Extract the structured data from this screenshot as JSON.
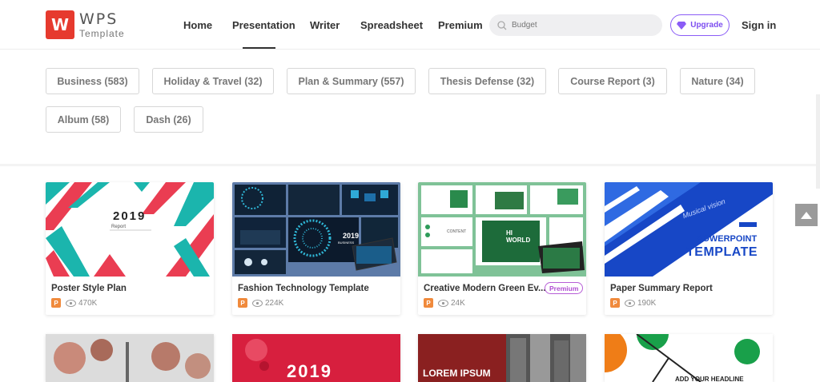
{
  "brand": {
    "mark": "W",
    "name": "WPS",
    "sub": "Template",
    "color": "#e63a2e"
  },
  "nav": [
    {
      "label": "Home"
    },
    {
      "label": "Presentation"
    },
    {
      "label": "Writer"
    },
    {
      "label": "Spreadsheet"
    },
    {
      "label": "Premium"
    }
  ],
  "search": {
    "placeholder": "Budget"
  },
  "upgrade": {
    "label": "Upgrade",
    "color": "#7d4ef0"
  },
  "signin": {
    "label": "Sign in"
  },
  "categories": [
    {
      "label": "Business (583)"
    },
    {
      "label": "Holiday & Travel (32)"
    },
    {
      "label": "Plan & Summary (557)"
    },
    {
      "label": "Thesis Defense (32)"
    },
    {
      "label": "Course Report (3)"
    },
    {
      "label": "Nature (34)"
    },
    {
      "label": "Album (58)"
    },
    {
      "label": "Dash (26)"
    }
  ],
  "cards": [
    {
      "title": "Poster Style Plan",
      "views": "470K",
      "thumb_text": "2019",
      "thumb_sub": "Report",
      "premium": ""
    },
    {
      "title": "Fashion Technology Template",
      "views": "224K",
      "thumb_text": "2019",
      "thumb_sub": "BUSINESS",
      "premium": ""
    },
    {
      "title": "Creative Modern Green Ev...",
      "views": "24K",
      "thumb_text": "HI WORLD",
      "thumb_sub": "CONTENT",
      "premium": "Premium"
    },
    {
      "title": "Paper Summary Report",
      "views": "190K",
      "thumb_text": "POWERPOINT",
      "thumb_sub": "TEMPLATE",
      "thumb_tag": "Musical vision",
      "premium": ""
    }
  ],
  "row2": [
    {
      "thumb_text": ""
    },
    {
      "thumb_text": "2019"
    },
    {
      "thumb_text": "LOREM IPSUM"
    },
    {
      "thumb_text": "ADD YOUR HEADLINE"
    }
  ],
  "colors": {
    "accent": "#7d4ef0",
    "ppt": "#f08a3c",
    "teal": "#1bb5ad",
    "red": "#ea3d52",
    "blue": "#1747c6",
    "green": "#2e9b5a"
  }
}
